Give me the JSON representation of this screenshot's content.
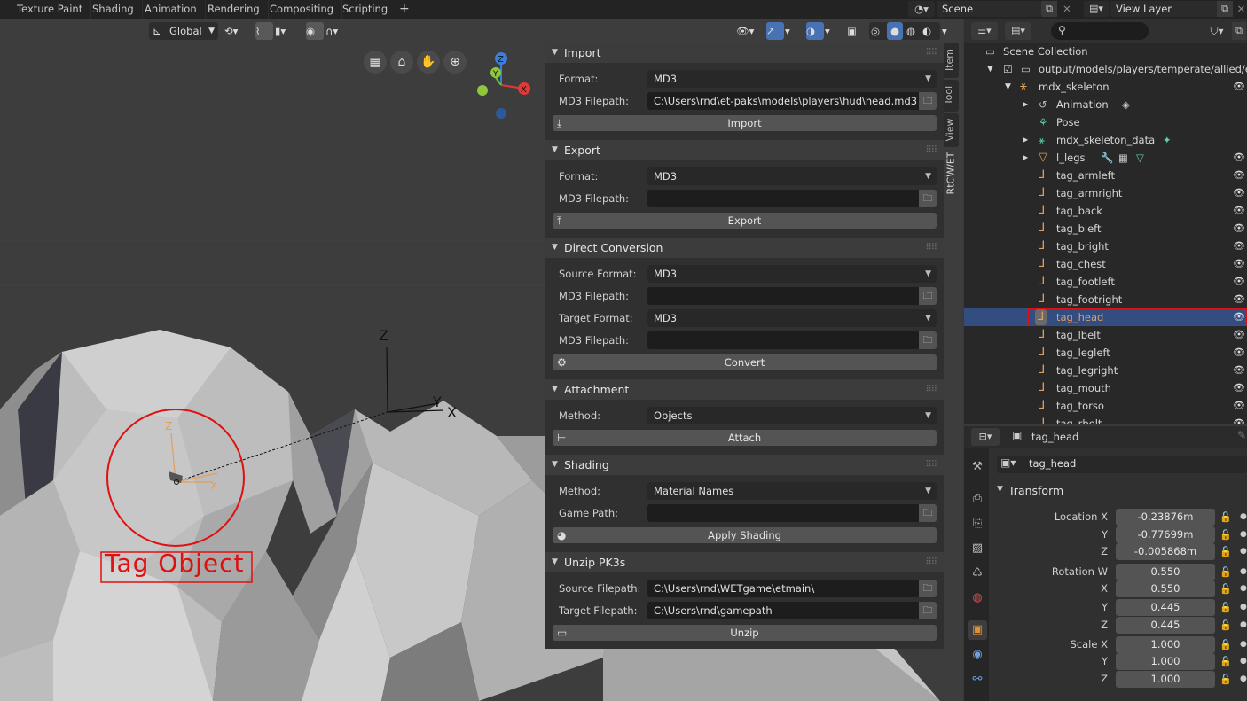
{
  "workspace_tabs": [
    "Texture Paint",
    "Shading",
    "Animation",
    "Rendering",
    "Compositing",
    "Scripting"
  ],
  "scene": {
    "label": "Scene"
  },
  "view_layer": {
    "label": "View Layer"
  },
  "viewport": {
    "transform_orientation": "Global",
    "annotation": "Tag Object",
    "axis_labels": {
      "z": "Z",
      "y": "Y",
      "x": "X"
    }
  },
  "npanel": {
    "vertical_tabs": [
      "Item",
      "Tool",
      "View",
      "RtCW/ET"
    ],
    "import": {
      "title": "Import",
      "format_label": "Format:",
      "format_value": "MD3",
      "filepath_label": "MD3 Filepath:",
      "filepath_value": "C:\\Users\\rnd\\et-paks\\models\\players\\hud\\head.md3",
      "button": "Import"
    },
    "export": {
      "title": "Export",
      "format_label": "Format:",
      "format_value": "MD3",
      "filepath_label": "MD3 Filepath:",
      "filepath_value": "",
      "button": "Export"
    },
    "direct_conversion": {
      "title": "Direct Conversion",
      "source_format_label": "Source Format:",
      "source_format_value": "MD3",
      "source_filepath_label": "MD3 Filepath:",
      "source_filepath_value": "",
      "target_format_label": "Target Format:",
      "target_format_value": "MD3",
      "target_filepath_label": "MD3 Filepath:",
      "target_filepath_value": "",
      "button": "Convert"
    },
    "attachment": {
      "title": "Attachment",
      "method_label": "Method:",
      "method_value": "Objects",
      "button": "Attach"
    },
    "shading": {
      "title": "Shading",
      "method_label": "Method:",
      "method_value": "Material Names",
      "game_path_label": "Game Path:",
      "game_path_value": "",
      "button": "Apply Shading"
    },
    "unzip": {
      "title": "Unzip PK3s",
      "source_label": "Source Filepath:",
      "source_value": "C:\\Users\\rnd\\WETgame\\etmain\\",
      "target_label": "Target Filepath:",
      "target_value": "C:\\Users\\rnd\\gamepath",
      "button": "Unzip"
    }
  },
  "outliner": {
    "scene_collection": "Scene Collection",
    "collection": "output/models/players/temperate/allied/engi",
    "items": [
      "mdx_skeleton",
      "Animation",
      "Pose",
      "mdx_skeleton_data",
      "l_legs",
      "tag_armleft",
      "tag_armright",
      "tag_back",
      "tag_bleft",
      "tag_bright",
      "tag_chest",
      "tag_footleft",
      "tag_footright",
      "tag_head",
      "tag_lbelt",
      "tag_legleft",
      "tag_legright",
      "tag_mouth",
      "tag_torso",
      "tag_rbelt"
    ],
    "selected": "tag_head"
  },
  "properties": {
    "object_name": "tag_head",
    "data_name": "tag_head",
    "transform_title": "Transform",
    "location_label": "Location X",
    "location": [
      "-0.23876m",
      "-0.77699m",
      "-0.005868m"
    ],
    "rotation_label": "Rotation W",
    "rotation": [
      "0.550",
      "0.550",
      "0.445",
      "0.445"
    ],
    "scale_label": "Scale X",
    "scale": [
      "1.000",
      "1.000",
      "1.000"
    ],
    "axis_y": "Y",
    "axis_z": "Z",
    "axis_x": "X"
  },
  "colors": {
    "selected_row": "#334d80",
    "highlight_box": "#e01010",
    "accent": "#e0a060"
  }
}
